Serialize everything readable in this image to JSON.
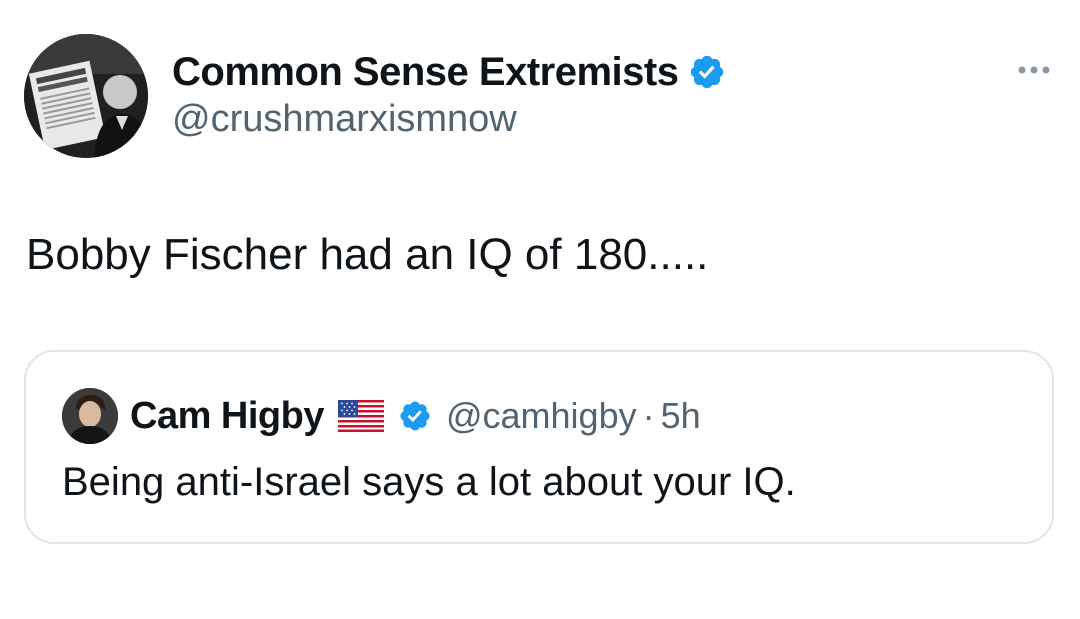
{
  "author": {
    "name": "Common Sense Extremists",
    "handle": "@crushmarxismnow",
    "verified_icon": "verified-badge-icon",
    "avatar_icon": "profile-photo-icon"
  },
  "more_icon": "more-options-icon",
  "tweet": {
    "text": "Bobby Fischer had an IQ of 180....."
  },
  "quote": {
    "name": "Cam Higby",
    "flag_icon": "us-flag-icon",
    "verified_icon": "verified-badge-icon",
    "handle": "@camhigby",
    "separator": "·",
    "time": "5h",
    "text": "Being anti-Israel says a lot about your IQ."
  },
  "colors": {
    "text": "#0f1419",
    "secondary": "#536471",
    "verified": "#1d9bf0",
    "border": "#e3e6e9"
  }
}
